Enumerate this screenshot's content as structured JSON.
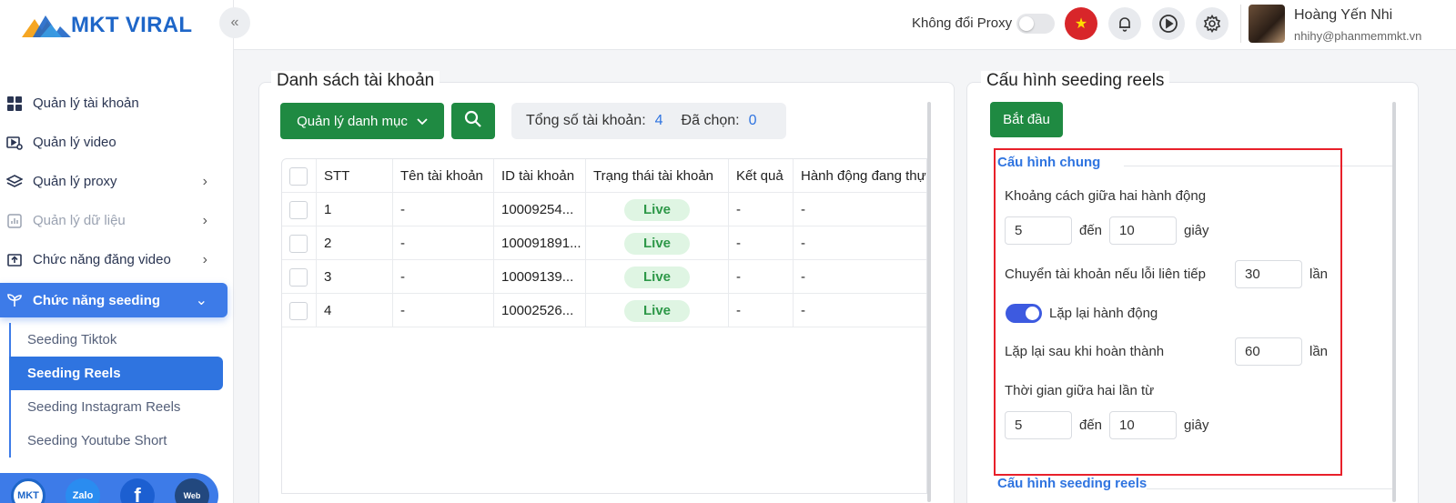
{
  "app": {
    "logo_text": "MKT VIRAL"
  },
  "sidebar": {
    "items": [
      {
        "label": "Quản lý tài khoản",
        "icon": "grid-icon"
      },
      {
        "label": "Quản lý video",
        "icon": "video-settings-icon"
      },
      {
        "label": "Quản lý proxy",
        "icon": "layers-icon"
      },
      {
        "label": "Quản lý dữ liệu",
        "icon": "chart-icon"
      },
      {
        "label": "Chức năng đăng video",
        "icon": "upload-icon"
      },
      {
        "label": "Chức năng seeding",
        "icon": "sprout-icon"
      }
    ],
    "sub_items": [
      "Seeding Tiktok",
      "Seeding Reels",
      "Seeding Instagram Reels",
      "Seeding Youtube Short"
    ],
    "social": [
      "MKT",
      "Zalo",
      "f",
      "Web"
    ]
  },
  "header": {
    "proxy_label": "Không đổi Proxy",
    "user_name": "Hoàng Yến Nhi",
    "user_email": "nhihy@phanmemmkt.vn"
  },
  "accounts": {
    "title": "Danh sách tài khoản",
    "manage_button": "Quản lý danh mục",
    "total_label": "Tổng số tài khoản:",
    "total_value": "4",
    "selected_label": "Đã chọn:",
    "selected_value": "0",
    "columns": [
      "STT",
      "Tên tài khoản",
      "ID tài khoản",
      "Trạng thái tài khoản",
      "Kết quả",
      "Hành động đang thự"
    ],
    "rows": [
      {
        "stt": "1",
        "name": "-",
        "id": "10009254...",
        "status": "Live",
        "result": "-",
        "action": "-"
      },
      {
        "stt": "2",
        "name": "-",
        "id": "100091891...",
        "status": "Live",
        "result": "-",
        "action": "-"
      },
      {
        "stt": "3",
        "name": "-",
        "id": "10009139...",
        "status": "Live",
        "result": "-",
        "action": "-"
      },
      {
        "stt": "4",
        "name": "-",
        "id": "10002526...",
        "status": "Live",
        "result": "-",
        "action": "-"
      }
    ]
  },
  "config": {
    "title": "Cấu hình seeding reels",
    "start_button": "Bắt đầu",
    "general_section": "Cấu hình chung",
    "delay_label": "Khoảng cách giữa hai hành động",
    "delay_from": "5",
    "delay_to": "10",
    "to_word": "đến",
    "sec_word": "giây",
    "switch_label": "Chuyển tài khoản nếu lỗi liên tiếp",
    "switch_value": "30",
    "times_word": "lần",
    "repeat_label": "Lặp lại hành động",
    "repeat_after_label": "Lặp lại sau khi hoàn thành",
    "repeat_after_value": "60",
    "interval_label": "Thời gian giữa hai lần từ",
    "interval_from": "5",
    "interval_to": "10",
    "reels_section": "Cấu hình seeding reels"
  }
}
